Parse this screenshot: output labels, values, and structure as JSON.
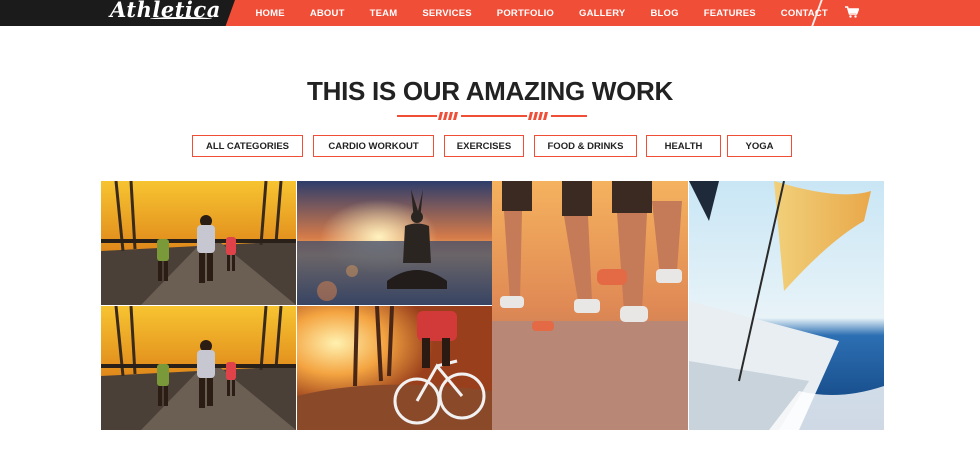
{
  "brand": {
    "logo_text": "Athletica"
  },
  "nav": {
    "items": [
      {
        "label": "HOME"
      },
      {
        "label": "ABOUT"
      },
      {
        "label": "TEAM"
      },
      {
        "label": "SERVICES"
      },
      {
        "label": "PORTFOLIO"
      },
      {
        "label": "GALLERY"
      },
      {
        "label": "BLOG"
      },
      {
        "label": "FEATURES"
      },
      {
        "label": "CONTACT"
      }
    ],
    "cart_icon": "shopping-cart-icon"
  },
  "section": {
    "title": "THIS IS OUR AMAZING WORK"
  },
  "filters": [
    {
      "label": "ALL CATEGORIES"
    },
    {
      "label": "CARDIO WORKOUT"
    },
    {
      "label": "EXERCISES"
    },
    {
      "label": "FOOD & DRINKS"
    },
    {
      "label": "HEALTH"
    },
    {
      "label": "YOGA"
    }
  ],
  "colors": {
    "accent": "#f04e37",
    "dark": "#1b1b1b",
    "heading": "#222222"
  },
  "gallery": {
    "items": [
      {
        "subject": "runners-bridge-sunset"
      },
      {
        "subject": "yoga-beach-sunset"
      },
      {
        "subject": "runners-legs-closeup"
      },
      {
        "subject": "sailboat-ocean"
      },
      {
        "subject": "runners-bridge-sunset"
      },
      {
        "subject": "cyclist-forest-sunset"
      }
    ]
  }
}
